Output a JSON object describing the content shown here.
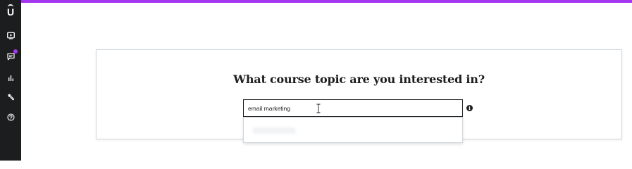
{
  "theme": {
    "accent": "#a435f0",
    "sidebar_bg": "#1c1d1f",
    "text": "#1c1d1f",
    "border": "#d1d7dc"
  },
  "sidebar": {
    "logo_letter": "U",
    "items": [
      {
        "icon": "play-icon"
      },
      {
        "icon": "chat-icon",
        "has_notification": true
      },
      {
        "icon": "bar-chart-icon"
      },
      {
        "icon": "wrench-icon"
      },
      {
        "icon": "help-icon"
      }
    ]
  },
  "main": {
    "question": "What course topic are you interested in?",
    "search": {
      "value": "email marketing",
      "placeholder": ""
    },
    "info_glyph": "i"
  }
}
